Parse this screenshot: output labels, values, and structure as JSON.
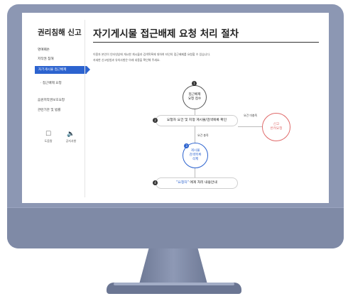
{
  "sidebar": {
    "title": "권리침해 신고",
    "items": [
      "명예훼손",
      "저작권 침해"
    ],
    "active": "자기게시물 접근배제",
    "sub": "· 접근배제 요청",
    "more": [
      "음원저작권보호요청",
      "관련기관 및 법률"
    ],
    "icons": [
      {
        "icon": "document-icon",
        "label": "도움말"
      },
      {
        "icon": "speaker-icon",
        "label": "공지사항"
      }
    ]
  },
  "main": {
    "title": "자기게시물 접근배제 요청 처리 절차",
    "desc1": "이용자 본인이 인터넷상에 게시한 게시물과 검색목록에 대하여 타인의 접근배제를 요청할 수 있습니다.",
    "desc2": "자세한 신고방법과 유의사항은 아래 내용을 확인해 주세요."
  },
  "flow": {
    "step1": {
      "num": "1",
      "line1": "접근배제",
      "line2": "요청 접수"
    },
    "step2": {
      "num": "2",
      "label": "요청자 요건 및 지정 게시물/검색목록 확인"
    },
    "step3": {
      "num": "3",
      "line1": "게시물",
      "line2": "검색목록",
      "line3": "삭제"
    },
    "step4": {
      "num": "4",
      "highlight": "\"요청자\"",
      "label": "에게 처리 내용안내"
    },
    "side": {
      "line1": "신고",
      "line2": "반려요청"
    },
    "branch_label": "요건 미충족",
    "down_label": "요건 충족"
  }
}
